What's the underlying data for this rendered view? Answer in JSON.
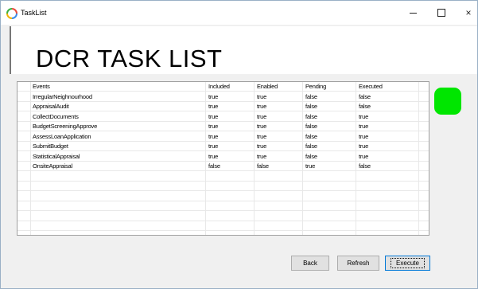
{
  "window": {
    "title": "TaskList",
    "controls": {
      "minimize": "minimize-icon",
      "maximize": "maximize-icon",
      "close": "×"
    }
  },
  "header": {
    "title": "DCR TASK LIST"
  },
  "table": {
    "columns": [
      "Events",
      "Included",
      "Enabled",
      "Pending",
      "Executed"
    ],
    "rows": [
      [
        "IrregularNeighnourhood",
        "true",
        "true",
        "false",
        "false"
      ],
      [
        "AppraisalAudit",
        "true",
        "true",
        "false",
        "false"
      ],
      [
        "CollectDocuments",
        "true",
        "true",
        "false",
        "true"
      ],
      [
        "BudgetScreeningApprove",
        "true",
        "true",
        "false",
        "true"
      ],
      [
        "AssessLoanApplication",
        "true",
        "true",
        "false",
        "true"
      ],
      [
        "SubmitBudget",
        "true",
        "true",
        "false",
        "true"
      ],
      [
        "StatisticalAppraisal",
        "true",
        "true",
        "false",
        "true"
      ],
      [
        "OnsiteAppraisal",
        "false",
        "false",
        "true",
        "false"
      ]
    ],
    "empty_rows": 6
  },
  "status": {
    "color": "#00e600"
  },
  "buttons": {
    "back": "Back",
    "refresh": "Refresh",
    "execute": "Execute"
  }
}
